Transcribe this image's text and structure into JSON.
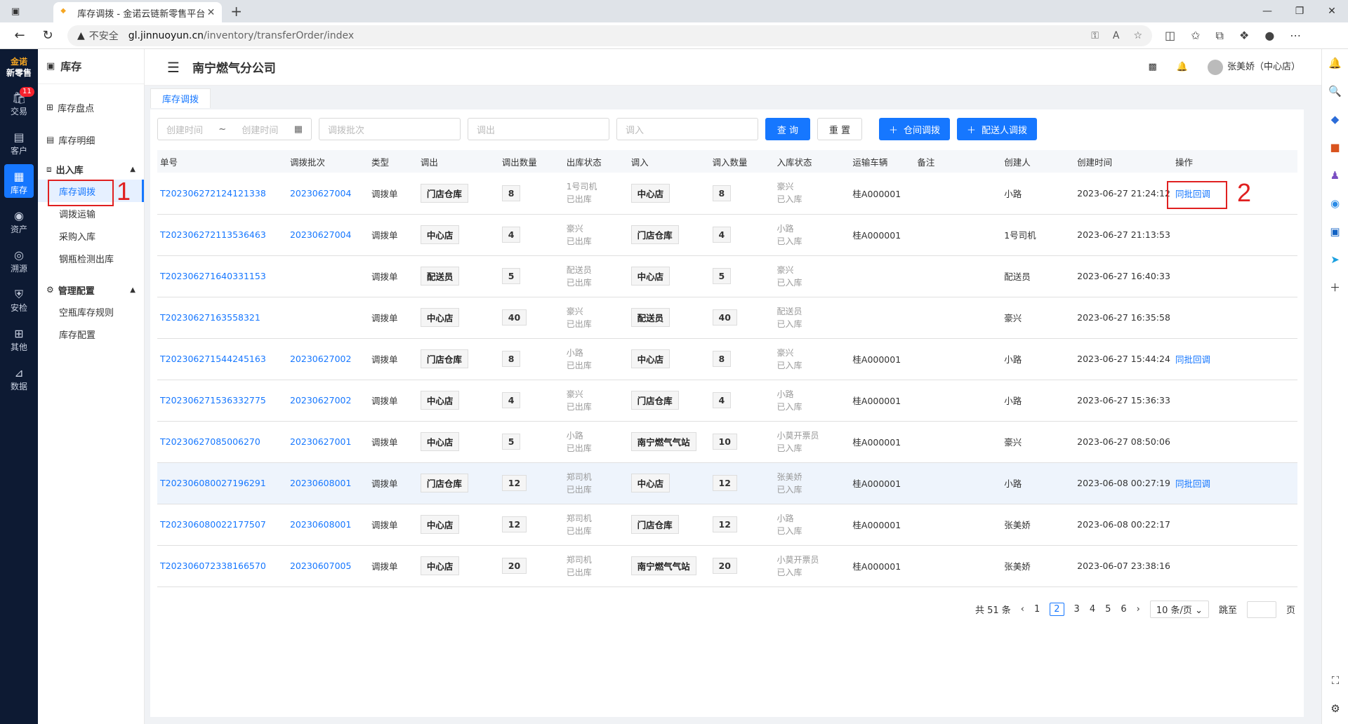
{
  "browser": {
    "tab_title": "库存调拨 - 金诺云链新零售平台",
    "insecure_label": "不安全",
    "url_host": "gl.jinnuoyun.cn",
    "url_path": "/inventory/transferOrder/index"
  },
  "left_nav": {
    "logo_line1": "金诺",
    "logo_line2": "新零售",
    "items": [
      {
        "label": "交易",
        "icon": "trade-icon",
        "badge": "11"
      },
      {
        "label": "客户",
        "icon": "customer-icon"
      },
      {
        "label": "库存",
        "icon": "inventory-icon"
      },
      {
        "label": "资产",
        "icon": "asset-icon"
      },
      {
        "label": "溯源",
        "icon": "trace-icon"
      },
      {
        "label": "安检",
        "icon": "shield-icon"
      },
      {
        "label": "其他",
        "icon": "grid-icon"
      },
      {
        "label": "数据",
        "icon": "chart-icon"
      }
    ]
  },
  "side_menu": {
    "title": "库存",
    "items": [
      "库存盘点",
      "库存明细"
    ],
    "group1": {
      "label": "出入库",
      "subs": [
        "库存调拨",
        "调拨运输",
        "采购入库",
        "钢瓶检测出库"
      ]
    },
    "group2": {
      "label": "管理配置",
      "subs": [
        "空瓶库存规则",
        "库存配置"
      ]
    }
  },
  "header": {
    "company": "南宁燃气分公司",
    "user": "张美娇（中心店）"
  },
  "page_tab": "库存调拨",
  "filters": {
    "start_placeholder": "创建时间",
    "tilde": "~",
    "end_placeholder": "创建时间",
    "batch_placeholder": "调拨批次",
    "out_placeholder": "调出",
    "in_placeholder": "调入",
    "query_label": "查 询",
    "reset_label": "重 置",
    "warehouse_transfer_label": "仓间调拨",
    "courier_transfer_label": "配送人调拨"
  },
  "table": {
    "headers": [
      "单号",
      "调拨批次",
      "类型",
      "调出",
      "调出数量",
      "出库状态",
      "调入",
      "调入数量",
      "入库状态",
      "运输车辆",
      "备注",
      "创建人",
      "创建时间",
      "操作"
    ],
    "rows": [
      {
        "no": "T202306272124121338",
        "batch": "20230627004",
        "type": "调拨单",
        "out": "门店仓库",
        "out_qty": "8",
        "out_person": "1号司机",
        "out_status": "已出库",
        "in": "中心店",
        "in_qty": "8",
        "in_person": "豪兴",
        "in_status": "已入库",
        "vehicle": "桂A000001",
        "remark": "",
        "creator": "小路",
        "time": "2023-06-27 21:24:12",
        "action": "同批回调"
      },
      {
        "no": "T202306272113536463",
        "batch": "20230627004",
        "type": "调拨单",
        "out": "中心店",
        "out_qty": "4",
        "out_person": "豪兴",
        "out_status": "已出库",
        "in": "门店仓库",
        "in_qty": "4",
        "in_person": "小路",
        "in_status": "已入库",
        "vehicle": "桂A000001",
        "remark": "",
        "creator": "1号司机",
        "time": "2023-06-27 21:13:53",
        "action": ""
      },
      {
        "no": "T202306271640331153",
        "batch": "",
        "type": "调拨单",
        "out": "配送员",
        "out_qty": "5",
        "out_person": "配送员",
        "out_status": "已出库",
        "in": "中心店",
        "in_qty": "5",
        "in_person": "豪兴",
        "in_status": "已入库",
        "vehicle": "",
        "remark": "",
        "creator": "配送员",
        "time": "2023-06-27 16:40:33",
        "action": ""
      },
      {
        "no": "T20230627163558321",
        "batch": "",
        "type": "调拨单",
        "out": "中心店",
        "out_qty": "40",
        "out_person": "豪兴",
        "out_status": "已出库",
        "in": "配送员",
        "in_qty": "40",
        "in_person": "配送员",
        "in_status": "已入库",
        "vehicle": "",
        "remark": "",
        "creator": "豪兴",
        "time": "2023-06-27 16:35:58",
        "action": ""
      },
      {
        "no": "T202306271544245163",
        "batch": "20230627002",
        "type": "调拨单",
        "out": "门店仓库",
        "out_qty": "8",
        "out_person": "小路",
        "out_status": "已出库",
        "in": "中心店",
        "in_qty": "8",
        "in_person": "豪兴",
        "in_status": "已入库",
        "vehicle": "桂A000001",
        "remark": "",
        "creator": "小路",
        "time": "2023-06-27 15:44:24",
        "action": "同批回调"
      },
      {
        "no": "T202306271536332775",
        "batch": "20230627002",
        "type": "调拨单",
        "out": "中心店",
        "out_qty": "4",
        "out_person": "豪兴",
        "out_status": "已出库",
        "in": "门店仓库",
        "in_qty": "4",
        "in_person": "小路",
        "in_status": "已入库",
        "vehicle": "桂A000001",
        "remark": "",
        "creator": "小路",
        "time": "2023-06-27 15:36:33",
        "action": ""
      },
      {
        "no": "T20230627085006270",
        "batch": "20230627001",
        "type": "调拨单",
        "out": "中心店",
        "out_qty": "5",
        "out_person": "小路",
        "out_status": "已出库",
        "in": "南宁燃气气站",
        "in_qty": "10",
        "in_person": "小莫开票员",
        "in_status": "已入库",
        "vehicle": "桂A000001",
        "remark": "",
        "creator": "豪兴",
        "time": "2023-06-27 08:50:06",
        "action": ""
      },
      {
        "no": "T202306080027196291",
        "batch": "20230608001",
        "type": "调拨单",
        "out": "门店仓库",
        "out_qty": "12",
        "out_person": "郑司机",
        "out_status": "已出库",
        "in": "中心店",
        "in_qty": "12",
        "in_person": "张美娇",
        "in_status": "已入库",
        "vehicle": "桂A000001",
        "remark": "",
        "creator": "小路",
        "time": "2023-06-08 00:27:19",
        "action": "同批回调"
      },
      {
        "no": "T202306080022177507",
        "batch": "20230608001",
        "type": "调拨单",
        "out": "中心店",
        "out_qty": "12",
        "out_person": "郑司机",
        "out_status": "已出库",
        "in": "门店仓库",
        "in_qty": "12",
        "in_person": "小路",
        "in_status": "已入库",
        "vehicle": "桂A000001",
        "remark": "",
        "creator": "张美娇",
        "time": "2023-06-08 00:22:17",
        "action": ""
      },
      {
        "no": "T202306072338166570",
        "batch": "20230607005",
        "type": "调拨单",
        "out": "中心店",
        "out_qty": "20",
        "out_person": "郑司机",
        "out_status": "已出库",
        "in": "南宁燃气气站",
        "in_qty": "20",
        "in_person": "小莫开票员",
        "in_status": "已入库",
        "vehicle": "桂A000001",
        "remark": "",
        "creator": "张美娇",
        "time": "2023-06-07 23:38:16",
        "action": ""
      }
    ]
  },
  "pager": {
    "total": "共 51 条",
    "pages": [
      "1",
      "2",
      "3",
      "4",
      "5",
      "6"
    ],
    "current": "2",
    "size": "10 条/页",
    "jump_label": "跳至",
    "page_suffix": "页"
  },
  "annotations": {
    "label1": "1",
    "label2": "2",
    "color": "#e02020"
  },
  "colors": {
    "primary": "#1677ff",
    "nav_bg": "#0d1a33"
  }
}
